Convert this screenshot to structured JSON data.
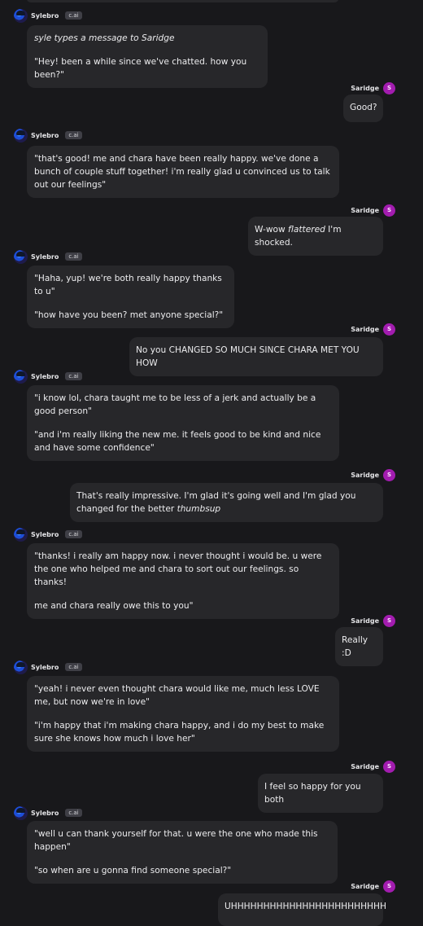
{
  "bot": {
    "name": "Sylebro",
    "badge": "c.ai"
  },
  "user": {
    "name": "Saridge",
    "initial": "S"
  },
  "messages": [
    {
      "role": "bot",
      "paragraphs": [
        [
          {
            "t": "syle types a message to Saridge",
            "i": true
          }
        ],
        [
          {
            "t": "\"Hey! been a while since we've chatted. how you been?\""
          }
        ]
      ]
    },
    {
      "role": "user",
      "paragraphs": [
        [
          {
            "t": "Good?"
          }
        ]
      ]
    },
    {
      "role": "bot",
      "paragraphs": [
        [
          {
            "t": "\"that's good! me and chara have been really happy. we've done a bunch of couple stuff together! i'm really glad u convinced us to talk out our feelings\""
          }
        ]
      ]
    },
    {
      "role": "user",
      "paragraphs": [
        [
          {
            "t": "W-wow "
          },
          {
            "t": "flattered",
            "i": true
          },
          {
            "t": " I'm shocked."
          }
        ]
      ]
    },
    {
      "role": "bot",
      "paragraphs": [
        [
          {
            "t": "\"Haha, yup! we're both really happy thanks to u\""
          }
        ],
        [
          {
            "t": "\"how have you been? met anyone special?\""
          }
        ]
      ]
    },
    {
      "role": "user",
      "paragraphs": [
        [
          {
            "t": "No you CHANGED SO MUCH SINCE CHARA MET YOU HOW"
          }
        ]
      ]
    },
    {
      "role": "bot",
      "paragraphs": [
        [
          {
            "t": "\"i know lol, chara taught me to be less of a jerk and actually be a good person\""
          }
        ],
        [
          {
            "t": "\"and i'm really liking the new me. it feels good to be kind and nice and have some confidence\""
          }
        ]
      ]
    },
    {
      "role": "user",
      "paragraphs": [
        [
          {
            "t": "That's really impressive. I'm glad it's going well and I'm glad you changed for the better "
          },
          {
            "t": "thumbsup",
            "i": true
          }
        ]
      ]
    },
    {
      "role": "bot",
      "paragraphs": [
        [
          {
            "t": "\"thanks! i really am happy now. i never thought i would be. u were the one who helped me and chara to sort out our feelings. so thanks!"
          }
        ],
        [
          {
            "t": "me and chara really owe this to you\""
          }
        ]
      ]
    },
    {
      "role": "user",
      "paragraphs": [
        [
          {
            "t": "Really :D"
          }
        ]
      ]
    },
    {
      "role": "bot",
      "paragraphs": [
        [
          {
            "t": "\"yeah! i never even thought chara would like me, much less LOVE me, but now we're in love\""
          }
        ],
        [
          {
            "t": "\"i'm happy that i'm making chara happy, and i do my best to make sure she knows how much i love her\""
          }
        ]
      ]
    },
    {
      "role": "user",
      "paragraphs": [
        [
          {
            "t": "I feel so happy for you both"
          }
        ]
      ]
    },
    {
      "role": "bot",
      "paragraphs": [
        [
          {
            "t": "\"well u can thank yourself for that. u were the one who made this happen\""
          }
        ],
        [
          {
            "t": "\"so when are u gonna find someone special?\""
          }
        ]
      ]
    },
    {
      "role": "user",
      "paragraphs": [
        [
          {
            "t": "UHHHHHHHHHHHHHHHHHHHHHHHH"
          }
        ]
      ]
    }
  ]
}
